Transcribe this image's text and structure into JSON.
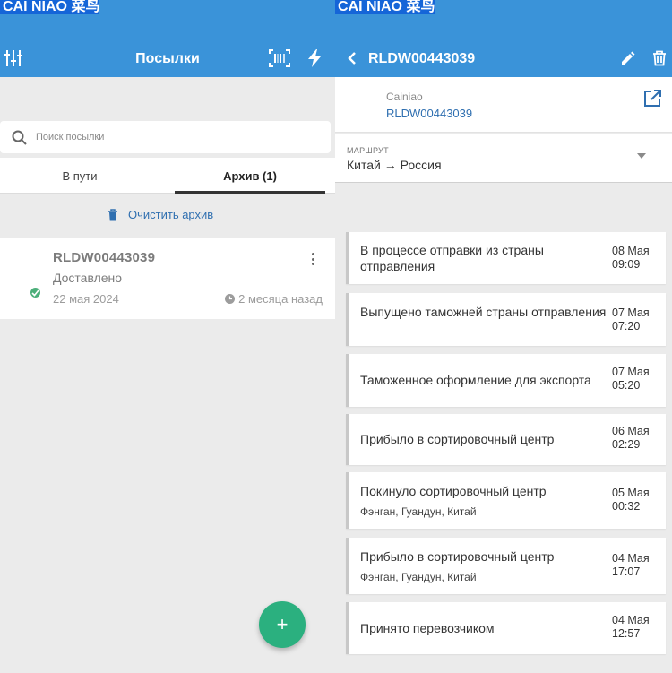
{
  "left": {
    "title": "Посылки",
    "search_placeholder": "Поиск посылки",
    "tabs": [
      {
        "label": "В пути",
        "active": false
      },
      {
        "label": "Архив (1)",
        "active": true
      }
    ],
    "clear_archive": "Очистить архив",
    "parcel": {
      "tracking": "RLDW00443039",
      "status": "Доставлено",
      "date": "22 мая 2024",
      "age": "2 месяца назад",
      "logo_text": "CAI NIAO 菜鸟"
    },
    "fab_label": "+"
  },
  "right": {
    "title": "RLDW00443039",
    "carrier": "Cainiao",
    "tracking": "RLDW00443039",
    "logo_text": "CAI NIAO 菜鸟",
    "route_label": "МАРШРУТ",
    "route_value": "Китай → Россия",
    "events": [
      {
        "text": "В процессе отправки из страны отправления",
        "sub": "",
        "date": "08 Мая",
        "time": "09:09"
      },
      {
        "text": "Выпущено таможней страны отправления",
        "sub": "",
        "date": "07 Мая",
        "time": "07:20"
      },
      {
        "text": "Таможенное оформление для экспорта",
        "sub": "",
        "date": "07 Мая",
        "time": "05:20"
      },
      {
        "text": "Прибыло в сортировочный центр",
        "sub": "",
        "date": "06 Мая",
        "time": "02:29"
      },
      {
        "text": "Покинуло сортировочный центр",
        "sub": "Фэнган, Гуандун, Китай",
        "date": "05 Мая",
        "time": "00:32"
      },
      {
        "text": "Прибыло в сортировочный центр",
        "sub": "Фэнган, Гуандун, Китай",
        "date": "04 Мая",
        "time": "17:07"
      },
      {
        "text": "Принято перевозчиком",
        "sub": "",
        "date": "04 Мая",
        "time": "12:57"
      }
    ]
  },
  "colors": {
    "appbar": "#3a93d9",
    "fab": "#2bb07f",
    "link": "#2f6fb0",
    "logo": "#1565d8",
    "check": "#4caf7a"
  },
  "icons": [
    "sliders-icon",
    "barcode-scan-icon",
    "lightning-icon",
    "search-icon",
    "trash-icon",
    "more-vert-icon",
    "clock-icon",
    "check-icon",
    "back-arrow-icon",
    "edit-pencil-icon",
    "external-link-icon",
    "dropdown-caret-icon"
  ]
}
